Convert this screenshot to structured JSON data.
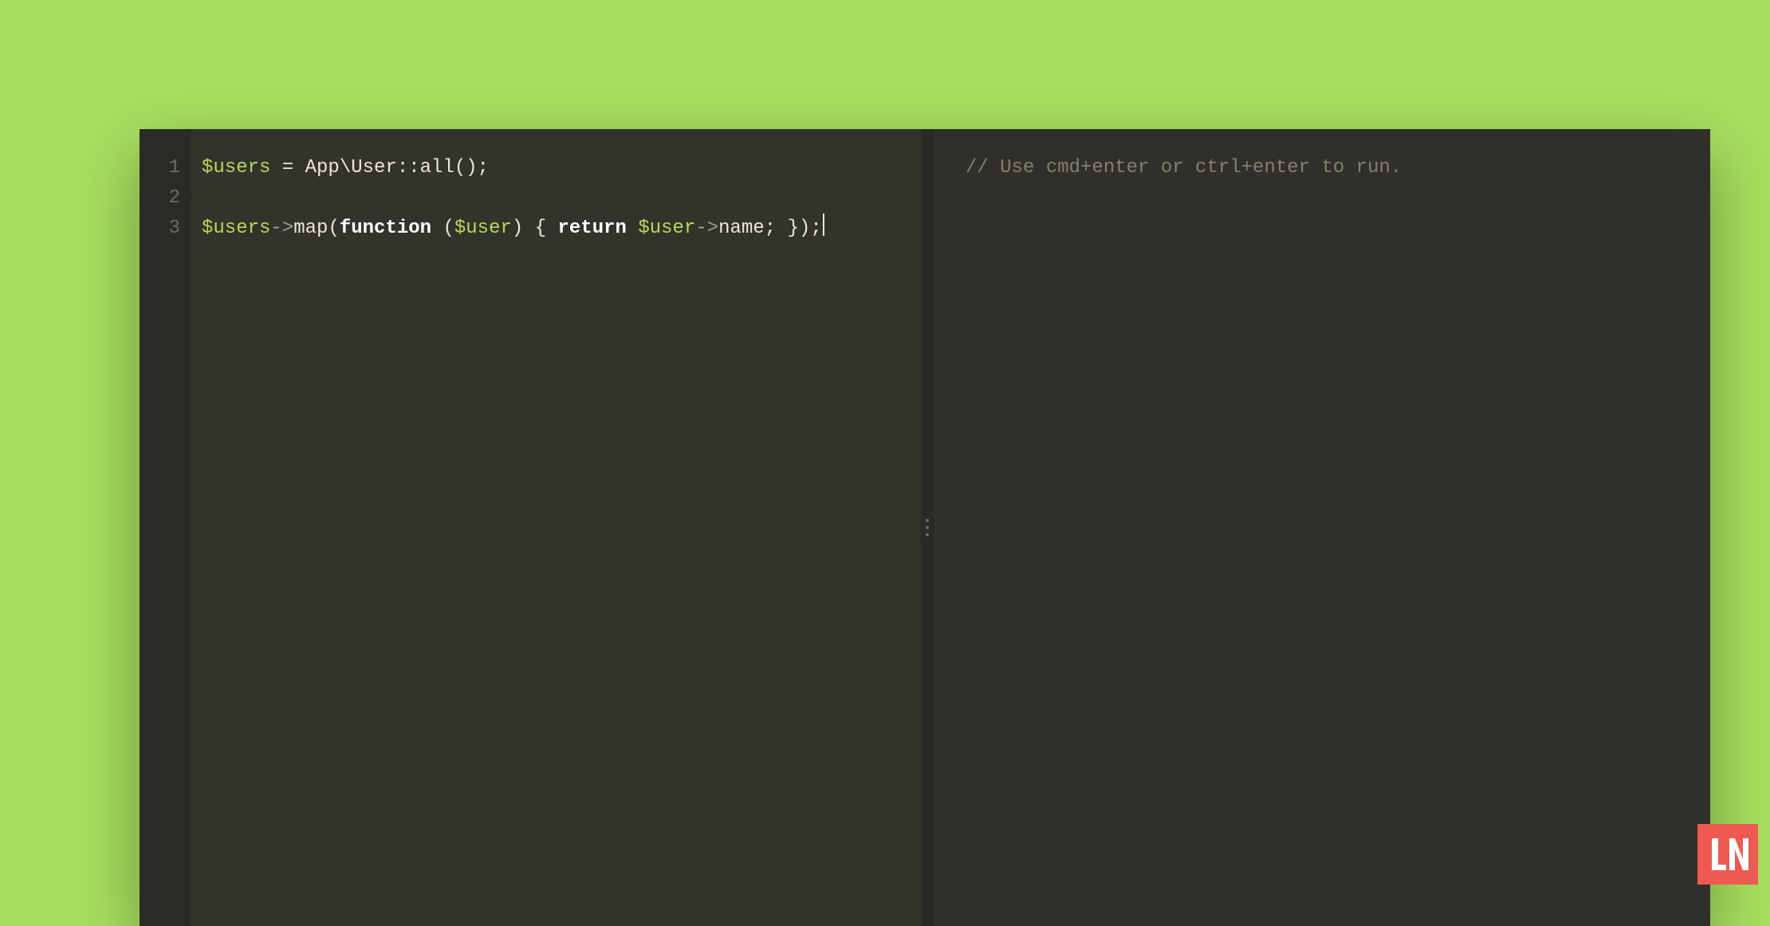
{
  "editor": {
    "gutter": [
      "1",
      "2",
      "3"
    ],
    "lines": [
      [
        {
          "cls": "tok-var",
          "t": "$users"
        },
        {
          "cls": "tok-plain",
          "t": " = App\\User::all();"
        }
      ],
      [],
      [
        {
          "cls": "tok-var",
          "t": "$users"
        },
        {
          "cls": "tok-arrow",
          "t": "->"
        },
        {
          "cls": "tok-plain",
          "t": "map("
        },
        {
          "cls": "tok-kw",
          "t": "function"
        },
        {
          "cls": "tok-plain",
          "t": " ("
        },
        {
          "cls": "tok-var",
          "t": "$user"
        },
        {
          "cls": "tok-plain",
          "t": ") { "
        },
        {
          "cls": "tok-kw",
          "t": "return"
        },
        {
          "cls": "tok-plain",
          "t": " "
        },
        {
          "cls": "tok-var",
          "t": "$user"
        },
        {
          "cls": "tok-arrow",
          "t": "->"
        },
        {
          "cls": "tok-plain",
          "t": "name; });"
        }
      ]
    ],
    "cursor_line": 2
  },
  "output": {
    "hint": "// Use cmd+enter or ctrl+enter to run."
  },
  "badge": {
    "label": "LN"
  }
}
